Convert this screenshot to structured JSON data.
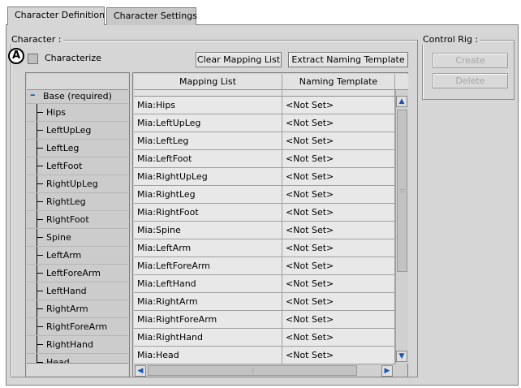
{
  "tabs": [
    {
      "label": "Character Definition",
      "active": true
    },
    {
      "label": "Character Settings",
      "active": false
    }
  ],
  "character_group": {
    "title": "Character :",
    "characterize_label": "Characterize",
    "characterize_checked": false,
    "clear_button": "Clear Mapping List",
    "extract_button": "Extract Naming Template",
    "callout": "A"
  },
  "control_rig_group": {
    "title": "Control Rig :",
    "create_button": "Create",
    "delete_button": "Delete"
  },
  "tree": {
    "root_label": "Base (required)",
    "root_expander": "–",
    "items": [
      "Hips",
      "LeftUpLeg",
      "LeftLeg",
      "LeftFoot",
      "RightUpLeg",
      "RightLeg",
      "RightFoot",
      "Spine",
      "LeftArm",
      "LeftForeArm",
      "LeftHand",
      "RightArm",
      "RightForeArm",
      "RightHand",
      "Head"
    ]
  },
  "grid": {
    "columns": [
      "Mapping List",
      "Naming Template"
    ],
    "rows": [
      [
        "Mia:Hips",
        "<Not Set>"
      ],
      [
        "Mia:LeftUpLeg",
        "<Not Set>"
      ],
      [
        "Mia:LeftLeg",
        "<Not Set>"
      ],
      [
        "Mia:LeftFoot",
        "<Not Set>"
      ],
      [
        "Mia:RightUpLeg",
        "<Not Set>"
      ],
      [
        "Mia:RightLeg",
        "<Not Set>"
      ],
      [
        "Mia:RightFoot",
        "<Not Set>"
      ],
      [
        "Mia:Spine",
        "<Not Set>"
      ],
      [
        "Mia:LeftArm",
        "<Not Set>"
      ],
      [
        "Mia:LeftForeArm",
        "<Not Set>"
      ],
      [
        "Mia:LeftHand",
        "<Not Set>"
      ],
      [
        "Mia:RightArm",
        "<Not Set>"
      ],
      [
        "Mia:RightForeArm",
        "<Not Set>"
      ],
      [
        "Mia:RightHand",
        "<Not Set>"
      ],
      [
        "Mia:Head",
        "<Not Set>"
      ]
    ]
  },
  "icons": {
    "scroll_up": "▲",
    "scroll_down": "▼",
    "scroll_left": "◀",
    "scroll_right": "▶"
  },
  "colors": {
    "panel_bg": "#d6d6d6",
    "scroll_arrow": "#1a54b0",
    "cell_bg": "#e8e8e8"
  }
}
